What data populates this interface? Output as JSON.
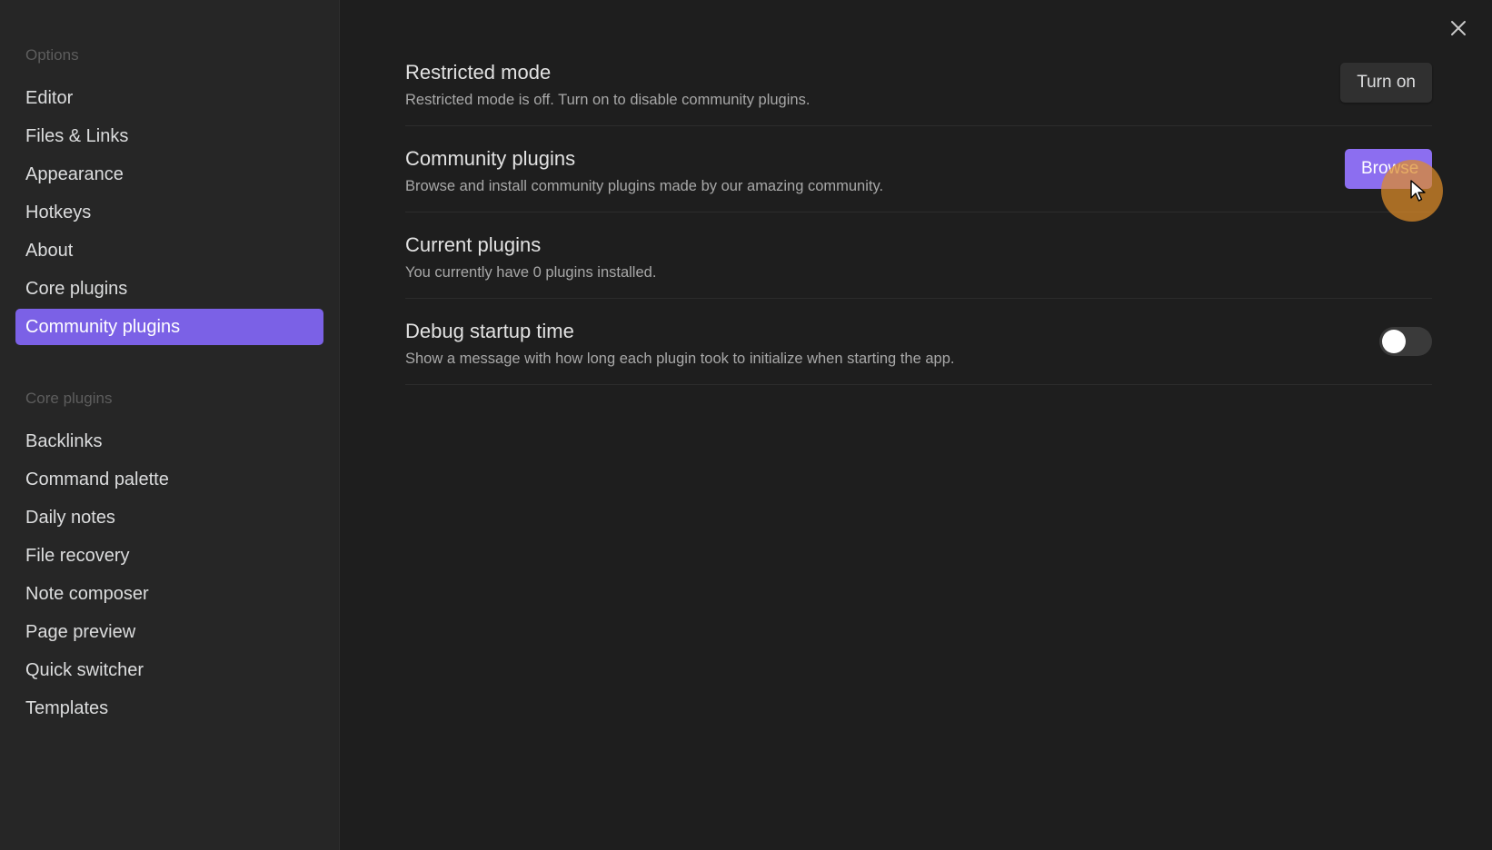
{
  "sidebar": {
    "options_heading": "Options",
    "options_items": [
      {
        "label": "Editor"
      },
      {
        "label": "Files & Links"
      },
      {
        "label": "Appearance"
      },
      {
        "label": "Hotkeys"
      },
      {
        "label": "About"
      },
      {
        "label": "Core plugins"
      },
      {
        "label": "Community plugins",
        "active": true
      }
    ],
    "core_heading": "Core plugins",
    "core_items": [
      {
        "label": "Backlinks"
      },
      {
        "label": "Command palette"
      },
      {
        "label": "Daily notes"
      },
      {
        "label": "File recovery"
      },
      {
        "label": "Note composer"
      },
      {
        "label": "Page preview"
      },
      {
        "label": "Quick switcher"
      },
      {
        "label": "Templates"
      }
    ]
  },
  "settings": [
    {
      "name": "Restricted mode",
      "desc": "Restricted mode is off. Turn on to disable community plugins.",
      "button": "Turn on"
    },
    {
      "name": "Community plugins",
      "desc": "Browse and install community plugins made by our amazing community.",
      "button": "Browse"
    },
    {
      "name": "Current plugins",
      "desc": "You currently have 0 plugins installed."
    },
    {
      "name": "Debug startup time",
      "desc": "Show a message with how long each plugin took to initialize when starting the app.",
      "toggle_on": false
    }
  ],
  "colors": {
    "accent": "#7b61e6",
    "cursor_highlight": "#de8c28"
  },
  "icons": {
    "close": "close-icon",
    "cursor": "mouse-cursor-icon"
  }
}
